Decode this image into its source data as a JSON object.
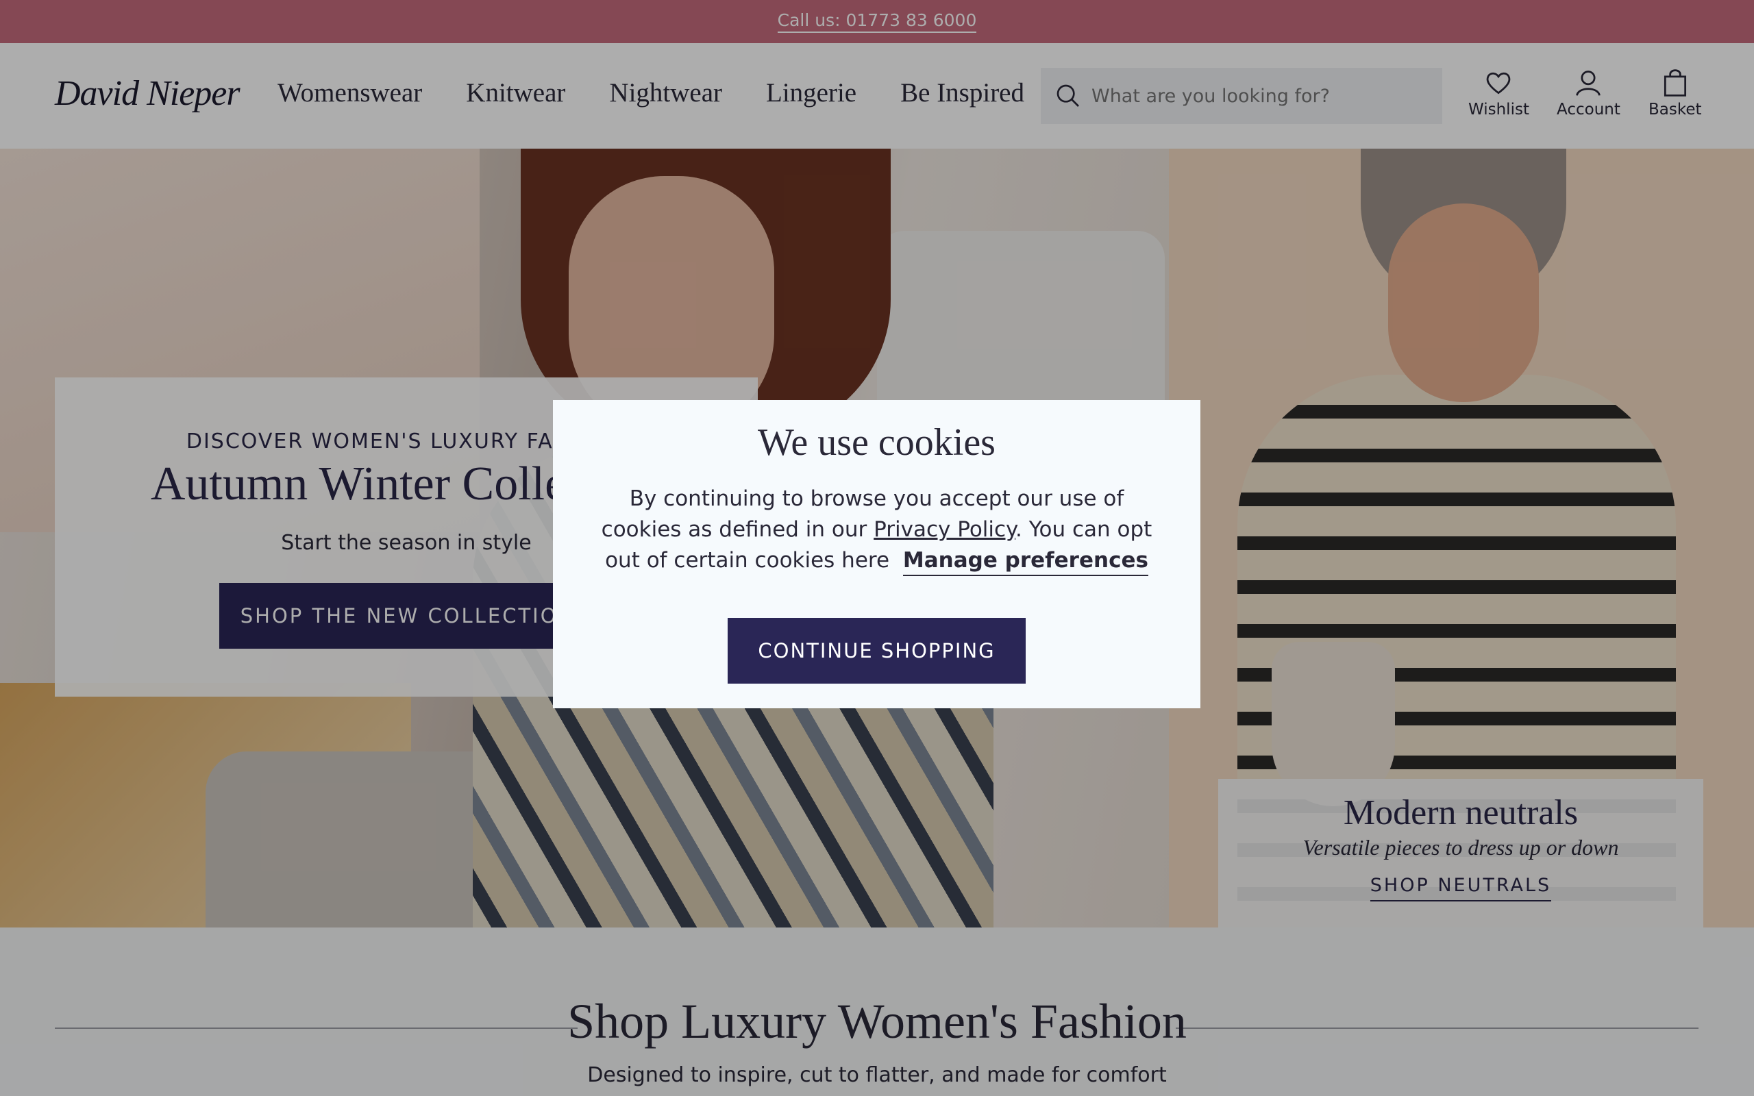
{
  "topbar": {
    "phone_text": "Call us: 01773 83 6000"
  },
  "header": {
    "logo": "David Nieper",
    "nav": [
      "Womenswear",
      "Knitwear",
      "Nightwear",
      "Lingerie",
      "Be Inspired"
    ],
    "search_placeholder": "What are you looking for?",
    "wishlist_label": "Wishlist",
    "account_label": "Account",
    "basket_label": "Basket"
  },
  "hero": {
    "eyebrow": "DISCOVER WOMEN'S LUXURY FASHION",
    "title": "Autumn Winter Collection",
    "subtitle": "Start the season in style",
    "cta": "SHOP THE NEW COLLECTION"
  },
  "neutrals": {
    "title": "Modern neutrals",
    "subtitle": "Versatile pieces to dress up or down",
    "link": "SHOP NEUTRALS"
  },
  "section": {
    "heading": "Shop Luxury Women's Fashion",
    "tagline": "Designed to inspire, cut to flatter, and made for comfort"
  },
  "cookie": {
    "title": "We use cookies",
    "text_1": "By continuing to browse you accept our use of cookies as defined in our",
    "privacy_link": "Privacy Policy",
    "text_2": ". You can opt out of certain cookies here",
    "manage_link": "Manage preferences",
    "button": "CONTINUE SHOPPING"
  },
  "colors": {
    "topbar": "#c56b7c",
    "button": "#2a2656",
    "overlay": "rgba(0,0,0,0.32)"
  }
}
